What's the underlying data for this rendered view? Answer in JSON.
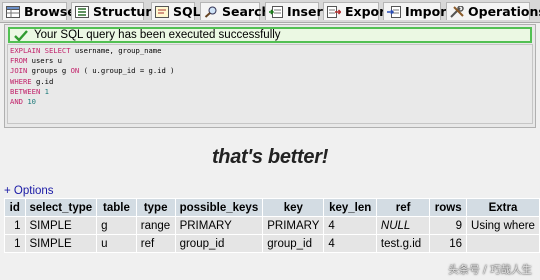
{
  "tabs": [
    {
      "label": "Browse",
      "icon": "browse-icon"
    },
    {
      "label": "Structure",
      "icon": "structure-icon"
    },
    {
      "label": "SQL",
      "icon": "sql-icon"
    },
    {
      "label": "Search",
      "icon": "search-icon"
    },
    {
      "label": "Insert",
      "icon": "insert-icon"
    },
    {
      "label": "Export",
      "icon": "export-icon"
    },
    {
      "label": "Import",
      "icon": "import-icon"
    },
    {
      "label": "Operations",
      "icon": "operations-icon"
    }
  ],
  "success_message": "Your SQL query has been executed successfully",
  "sql_lines": [
    [
      {
        "t": "kw",
        "s": "EXPLAIN SELECT "
      },
      {
        "t": "tx",
        "s": "username, group_name"
      }
    ],
    [
      {
        "t": "kw",
        "s": "FROM "
      },
      {
        "t": "tx",
        "s": "users u"
      }
    ],
    [
      {
        "t": "kw",
        "s": "JOIN "
      },
      {
        "t": "tx",
        "s": "groups g "
      },
      {
        "t": "kw",
        "s": "ON "
      },
      {
        "t": "tx",
        "s": "( u.group_id = g.id )"
      }
    ],
    [
      {
        "t": "kw",
        "s": "WHERE "
      },
      {
        "t": "tx",
        "s": "g.id"
      }
    ],
    [
      {
        "t": "kw",
        "s": "BETWEEN "
      },
      {
        "t": "num",
        "s": "1"
      }
    ],
    [
      {
        "t": "kw",
        "s": "AND "
      },
      {
        "t": "num",
        "s": "10"
      }
    ]
  ],
  "caption": "that's better!",
  "options_link": "+ Options",
  "table": {
    "headers": [
      "id",
      "select_type",
      "table",
      "type",
      "possible_keys",
      "key",
      "key_len",
      "ref",
      "rows",
      "Extra"
    ],
    "rows": [
      [
        "1",
        "SIMPLE",
        "g",
        "range",
        "PRIMARY",
        "PRIMARY",
        "4",
        "NULL",
        "9",
        "Using where"
      ],
      [
        "1",
        "SIMPLE",
        "u",
        "ref",
        "group_id",
        "group_id",
        "4",
        "test.g.id",
        "16",
        ""
      ]
    ]
  },
  "watermark": "头条号 / 巧哉人生",
  "colors": {
    "success_border": "#52c053",
    "keyword": "#c2236b",
    "number": "#1c7a7a",
    "link": "#1a1aa6",
    "table_header": "#d3dce3",
    "table_cell": "#e5e5e5"
  }
}
